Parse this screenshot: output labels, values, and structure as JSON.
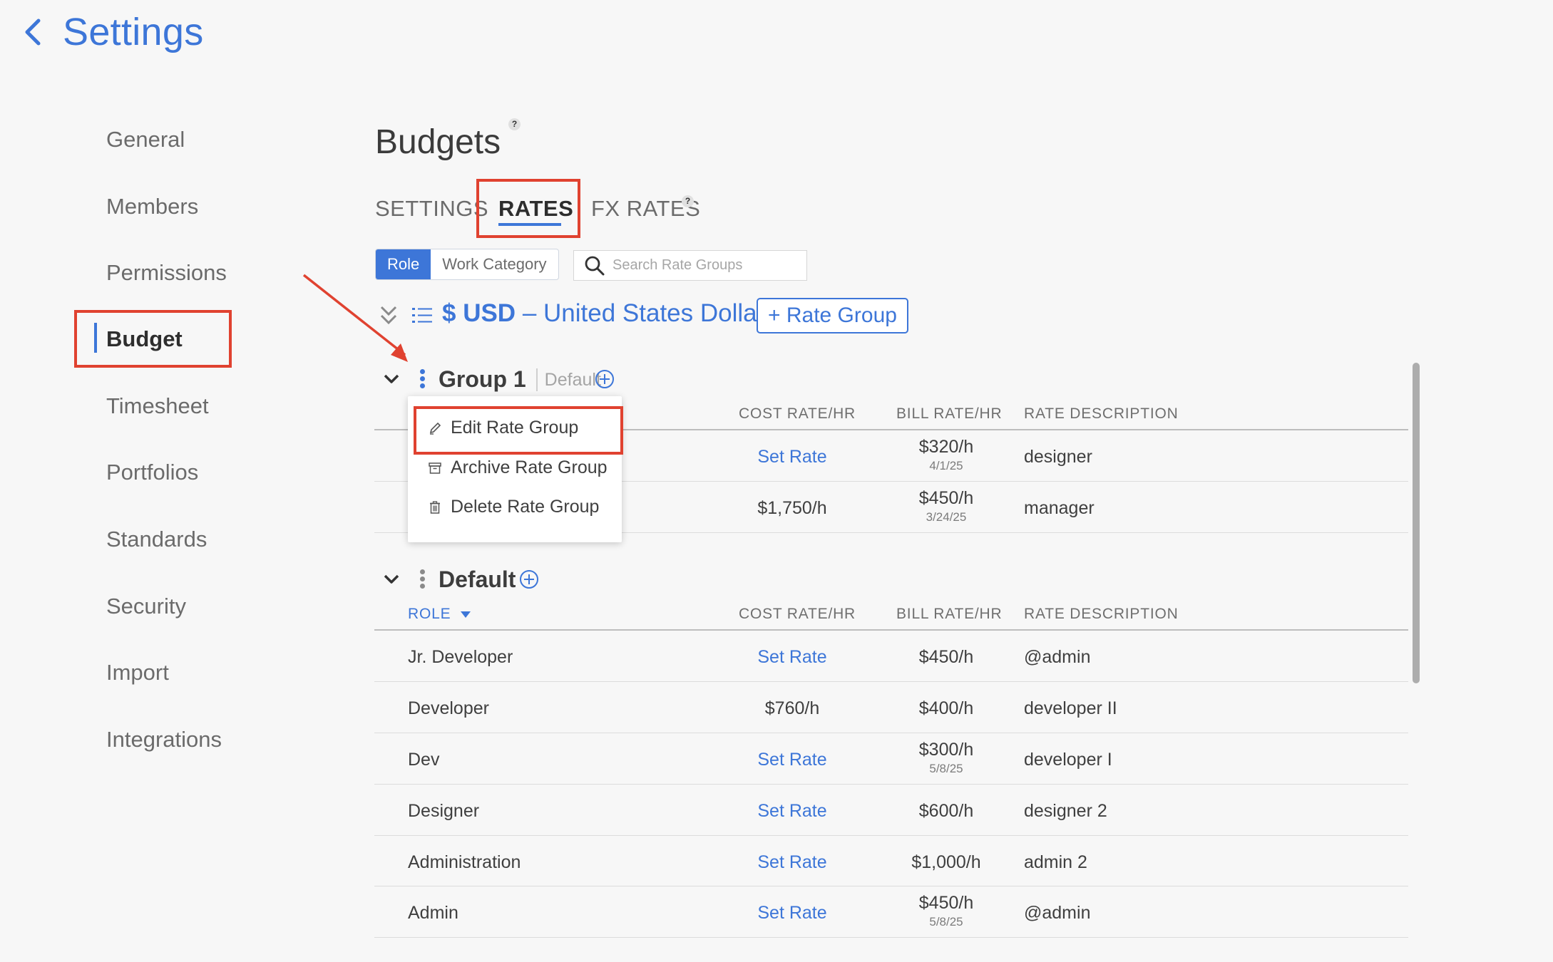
{
  "header": {
    "title": "Settings",
    "back_icon": "chevron-left-icon"
  },
  "sidebar": {
    "items": [
      {
        "label": "General"
      },
      {
        "label": "Members"
      },
      {
        "label": "Permissions"
      },
      {
        "label": "Budget",
        "active": true
      },
      {
        "label": "Timesheet"
      },
      {
        "label": "Portfolios"
      },
      {
        "label": "Standards"
      },
      {
        "label": "Security"
      },
      {
        "label": "Import"
      },
      {
        "label": "Integrations"
      }
    ]
  },
  "page": {
    "title": "Budgets",
    "help": "?"
  },
  "tabs": [
    {
      "label": "SETTINGS"
    },
    {
      "label": "RATES",
      "active": true
    },
    {
      "label": "FX RATES",
      "help": "?"
    }
  ],
  "toggle": {
    "options": [
      "Role",
      "Work Category"
    ],
    "selected": "Role"
  },
  "search": {
    "placeholder": "Search Rate Groups",
    "value": ""
  },
  "currency": {
    "code": "$ USD",
    "separator": "–",
    "name": "United States Dollar"
  },
  "add_rate_group": {
    "label": "+ Rate Group"
  },
  "columns": {
    "role": "ROLE",
    "cost": "COST RATE/HR",
    "bill": "BILL RATE/HR",
    "desc": "RATE DESCRIPTION"
  },
  "groups": [
    {
      "name": "Group 1",
      "tag": "Default",
      "rows": [
        {
          "cost": "Set Rate",
          "cost_is_link": true,
          "bill": "$320/h",
          "bill_date": "4/1/25",
          "desc": "designer"
        },
        {
          "cost": "$1,750/h",
          "cost_is_link": false,
          "bill": "$450/h",
          "bill_date": "3/24/25",
          "desc": "manager"
        }
      ]
    },
    {
      "name": "Default",
      "rows": [
        {
          "role": "Jr. Developer",
          "cost": "Set Rate",
          "cost_is_link": true,
          "bill": "$450/h",
          "bill_date": "",
          "desc": "@admin"
        },
        {
          "role": "Developer",
          "cost": "$760/h",
          "cost_is_link": false,
          "bill": "$400/h",
          "bill_date": "",
          "desc": "developer II"
        },
        {
          "role": "Dev",
          "cost": "Set Rate",
          "cost_is_link": true,
          "bill": "$300/h",
          "bill_date": "5/8/25",
          "desc": "developer I"
        },
        {
          "role": "Designer",
          "cost": "Set Rate",
          "cost_is_link": true,
          "bill": "$600/h",
          "bill_date": "",
          "desc": "designer 2"
        },
        {
          "role": "Administration",
          "cost": "Set Rate",
          "cost_is_link": true,
          "bill": "$1,000/h",
          "bill_date": "",
          "desc": "admin 2"
        },
        {
          "role": "Admin",
          "cost": "Set Rate",
          "cost_is_link": true,
          "bill": "$450/h",
          "bill_date": "5/8/25",
          "desc": "@admin"
        }
      ]
    }
  ],
  "context_menu": {
    "items": [
      {
        "label": "Edit Rate Group",
        "icon": "pencil-icon"
      },
      {
        "label": "Archive Rate Group",
        "icon": "archive-icon"
      },
      {
        "label": "Delete Rate Group",
        "icon": "trash-icon"
      }
    ]
  },
  "colors": {
    "accent": "#3d76d8",
    "highlight": "#e04230",
    "text": "#4a4a4a"
  }
}
